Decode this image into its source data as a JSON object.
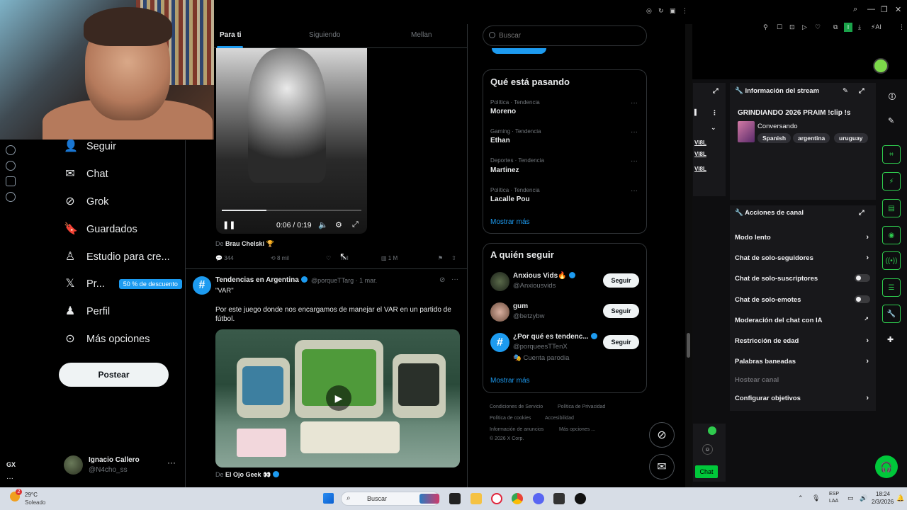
{
  "weather": {
    "temp": "29°C",
    "desc": "Soleado"
  },
  "rail": {
    "gx_label": "GX"
  },
  "nav": {
    "items": [
      {
        "label": "Seguir",
        "icon": "add-user-icon"
      },
      {
        "label": "Chat",
        "icon": "mail-icon"
      },
      {
        "label": "Grok",
        "icon": "grok-icon"
      },
      {
        "label": "Guardados",
        "icon": "bookmark-icon"
      },
      {
        "label": "Estudio para cre...",
        "icon": "studio-icon"
      },
      {
        "label": "Pr...",
        "icon": "x-logo-icon",
        "badge": "50 % de descuento"
      },
      {
        "label": "Perfil",
        "icon": "person-icon"
      },
      {
        "label": "Más opciones",
        "icon": "more-circle-icon"
      }
    ],
    "post_button": "Postear"
  },
  "account": {
    "name": "Ignacio Callero",
    "handle": "@N4cho_ss",
    "more": "···"
  },
  "tabs": [
    "Para ti",
    "Siguiendo",
    "Mellan"
  ],
  "post1": {
    "video_time": "0:06 / 0:19",
    "video_progress": 0.32,
    "from_label": "De",
    "from_name": "Brau Chelski 🏆",
    "replies": "344",
    "reposts": "8 mil",
    "likes": "mil",
    "views": "1 M"
  },
  "post2": {
    "avatar_char": "#",
    "name": "Tendencias en Argentina",
    "handle": "@porqueTTarg · 1 mar.",
    "quote": "\"VAR\"",
    "text": "Por este juego donde nos encargamos de manejar el VAR en un partido de fútbol."
  },
  "post3": {
    "from_label": "De",
    "from_name": "El Ojo Geek 👀"
  },
  "search": {
    "placeholder": "Buscar"
  },
  "trends": {
    "title": "Qué está pasando",
    "items": [
      {
        "category": "Política · Tendencia",
        "name": "Moreno"
      },
      {
        "category": "Gaming · Tendencia",
        "name": "Ethan"
      },
      {
        "category": "Deportes · Tendencia",
        "name": "Martinez"
      },
      {
        "category": "Política · Tendencia",
        "name": "Lacalle Pou"
      }
    ],
    "show_more": "Mostrar más",
    "item_more": "···"
  },
  "who_to_follow": {
    "title": "A quién seguir",
    "items": [
      {
        "name": "Anxious Vids🔥",
        "handle": "@Anxiousvids",
        "extra": ""
      },
      {
        "name": "gum",
        "handle": "@betzybw",
        "extra": ""
      },
      {
        "name": "¿Por qué es tendenc...",
        "handle": "@porqueesTTenX",
        "extra": "🎭 Cuenta parodia"
      }
    ],
    "follow_label": "Seguir",
    "show_more": "Mostrar más"
  },
  "legal": {
    "line1a": "Condiciones de Servicio",
    "line1b": "Política de Privacidad",
    "line2a": "Política de cookies",
    "line2b": "Accesibilidad",
    "line3a": "Información de anuncios",
    "line3b": "Más opciones ...",
    "copyright": "© 2026 X Corp."
  },
  "twitch": {
    "stream_info_title": "Información del stream",
    "stream_title": "GRINDIANDO 2026 PRAIM !clip !s",
    "category": "Conversando",
    "tags": [
      "Spanish",
      "argentina",
      "uruguay"
    ],
    "channel_actions_title": "Acciones de canal",
    "actions": [
      {
        "label": "Modo lento",
        "control": "chevron"
      },
      {
        "label": "Chat de solo-seguidores",
        "control": "chevron"
      },
      {
        "label": "Chat de solo-suscriptores",
        "control": "toggle"
      },
      {
        "label": "Chat de solo-emotes",
        "control": "toggle"
      },
      {
        "label": "Moderación del chat con IA",
        "control": "external"
      },
      {
        "label": "Restricción de edad",
        "control": "chevron"
      },
      {
        "label": "Palabras baneadas",
        "control": "chevron"
      }
    ],
    "host_label": "Hostear canal",
    "goals_label": "Configurar objetivos",
    "left_strip": [
      "VI8L",
      "VI8L",
      "VI8L"
    ],
    "chat_button": "Chat"
  },
  "taskbar": {
    "search": "Buscar",
    "lang": "ESP",
    "lang2": "LAA",
    "time": "18:24",
    "date": "2/3/2026",
    "notif_count": "2"
  },
  "colors": {
    "x_blue": "#1d9bf0",
    "twitch_green": "#2fcb4e",
    "bg": "#000000"
  }
}
